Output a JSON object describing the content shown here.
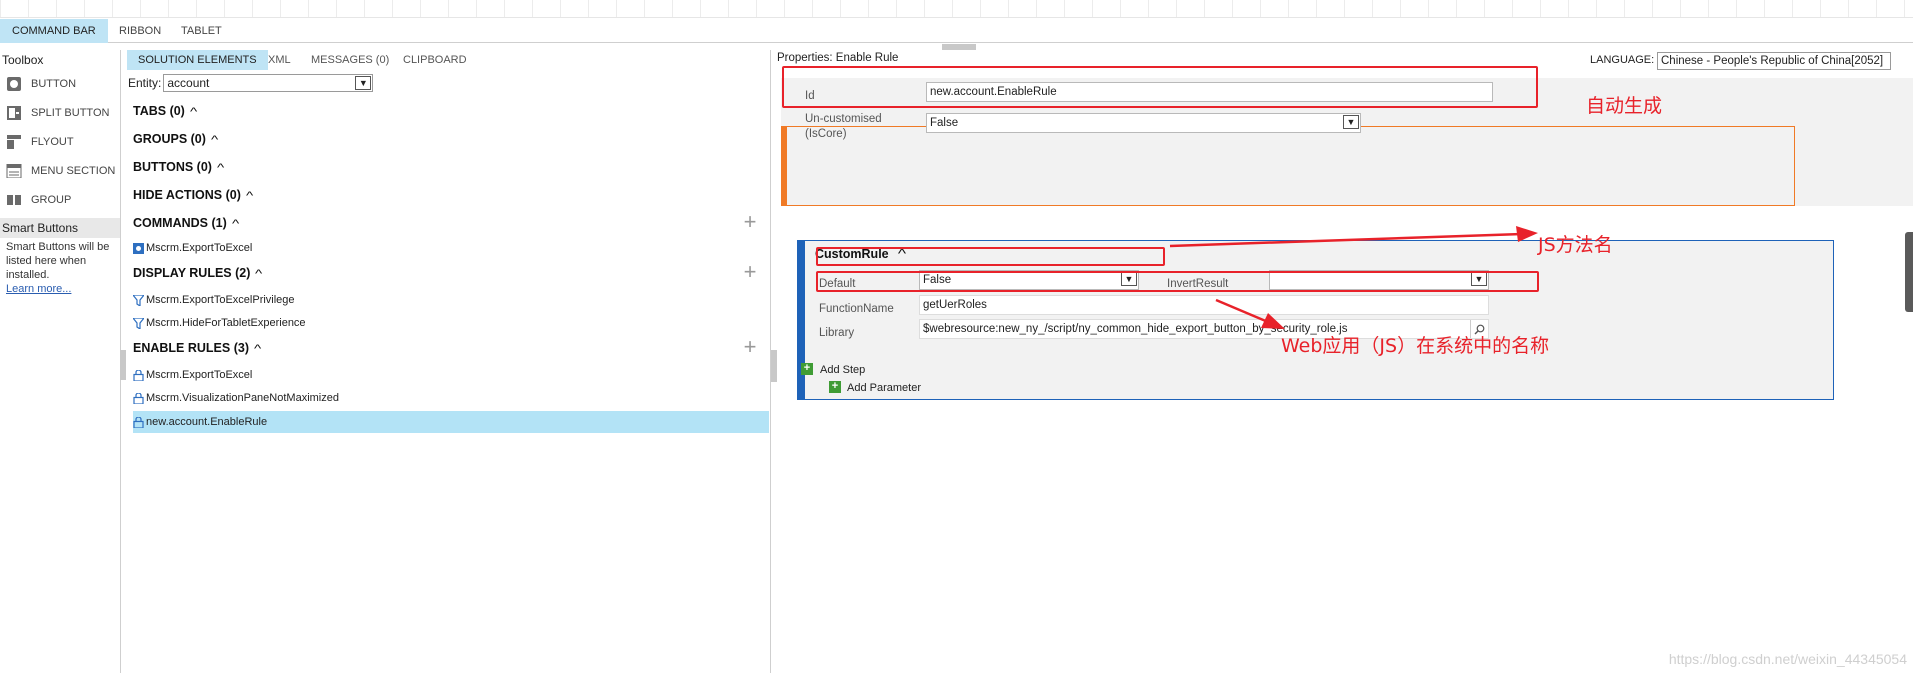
{
  "top_tabs": [
    {
      "label": "COMMAND BAR"
    },
    {
      "label": "RIBBON"
    },
    {
      "label": "TABLET"
    }
  ],
  "toolbox": {
    "title": "Toolbox",
    "items": [
      {
        "label": "BUTTON",
        "icon": "button-icon"
      },
      {
        "label": "SPLIT BUTTON",
        "icon": "split-button-icon"
      },
      {
        "label": "FLYOUT",
        "icon": "flyout-icon"
      },
      {
        "label": "MENU SECTION",
        "icon": "menu-section-icon"
      },
      {
        "label": "GROUP",
        "icon": "group-icon"
      }
    ],
    "smart_title": "Smart Buttons",
    "smart_text": "Smart Buttons will be listed here when installed.",
    "smart_link": "Learn more..."
  },
  "solution": {
    "tabs": [
      {
        "label": "SOLUTION ELEMENTS"
      },
      {
        "label": "XML"
      },
      {
        "label": "MESSAGES (0)"
      },
      {
        "label": "CLIPBOARD"
      }
    ],
    "entity_label": "Entity:",
    "entity_value": "account",
    "sections": {
      "tabs": "TABS (0)",
      "groups": "GROUPS (0)",
      "buttons": "BUTTONS (0)",
      "hide_actions": "HIDE ACTIONS (0)",
      "commands": "COMMANDS (1)",
      "display_rules": "DISPLAY RULES (2)",
      "enable_rules": "ENABLE RULES (3)"
    },
    "commands": [
      "Mscrm.ExportToExcel"
    ],
    "display_rules": [
      "Mscrm.ExportToExcelPrivilege",
      "Mscrm.HideForTabletExperience"
    ],
    "enable_rules": [
      "Mscrm.ExportToExcel",
      "Mscrm.VisualizationPaneNotMaximized",
      "new.account.EnableRule"
    ]
  },
  "properties": {
    "title": "Properties: Enable Rule",
    "language_label": "LANGUAGE:",
    "language_value": "Chinese - People's Republic of China[2052]",
    "id_label": "Id",
    "id_value": "new.account.EnableRule",
    "uncustomised_label_1": "Un-customised",
    "uncustomised_label_2": "(IsCore)",
    "uncustomised_value": "False",
    "custom_rule": {
      "title": "CustomRule",
      "default_label": "Default",
      "default_value": "False",
      "invert_label": "InvertResult",
      "invert_value": "",
      "function_label": "FunctionName",
      "function_value": "getUerRoles",
      "library_label": "Library",
      "library_value": "$webresource:new_ny_/script/ny_common_hide_export_button_by_security_role.js",
      "add_parameter": "Add Parameter"
    },
    "add_step": "Add Step"
  },
  "annotations": {
    "auto_generated": "自动生成",
    "js_method": "JS方法名",
    "web_resource": "Web应用（JS）在系统中的名称"
  },
  "watermark": "https://blog.csdn.net/weixin_44345054",
  "colors": {
    "active_tab": "#bfe4f5",
    "orange_accent": "#f07a26",
    "blue_accent": "#1e62b8",
    "annotation_red": "#e8222a",
    "add_green": "#3f9c35"
  }
}
